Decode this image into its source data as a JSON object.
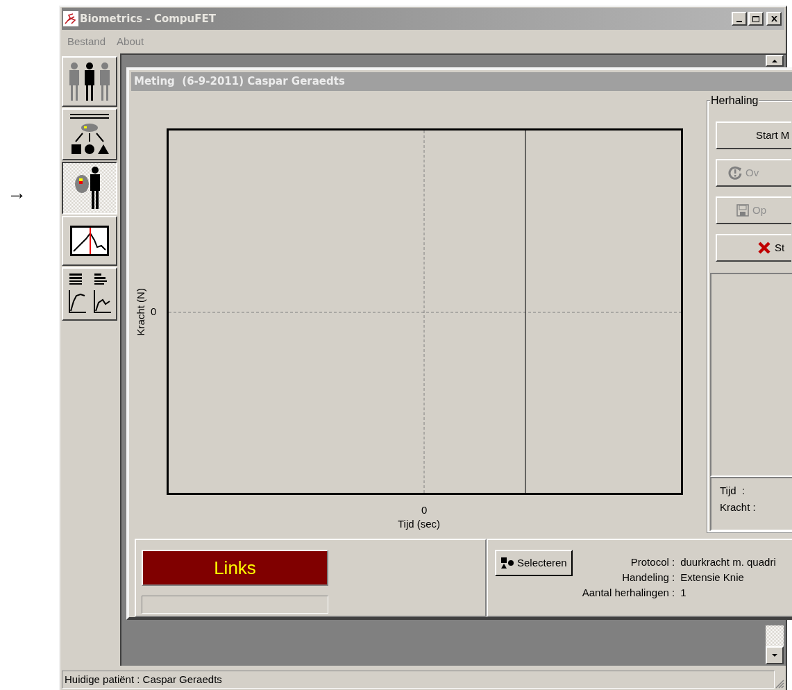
{
  "annotation": {
    "arrow": "→"
  },
  "window": {
    "title": "Biometrics - CompuFET"
  },
  "menu": [
    {
      "label": "Bestand"
    },
    {
      "label": "About"
    }
  ],
  "toolbar": [
    {
      "kind": "patients",
      "selected": false
    },
    {
      "kind": "protocols",
      "selected": false
    },
    {
      "kind": "measure",
      "selected": true
    },
    {
      "kind": "analysis",
      "selected": false
    },
    {
      "kind": "reports",
      "selected": false
    }
  ],
  "child_window": {
    "title": "Meting  (6-9-2011) Caspar Geraedts"
  },
  "plot": {
    "ylabel": "Kracht (N)",
    "ytick": "0",
    "xtick": "0",
    "xlabel": "Tijd (sec)"
  },
  "herhaling": {
    "title": "Herhaling",
    "buttons": [
      {
        "label": "Start M",
        "kind": "start",
        "disabled": false
      },
      {
        "label": "Ov",
        "kind": "retry",
        "disabled": true
      },
      {
        "label": "Op",
        "kind": "save",
        "disabled": true
      },
      {
        "label": "St",
        "kind": "stop",
        "disabled": false
      }
    ],
    "readouts": [
      {
        "label": "Tijd  :"
      },
      {
        "label": "Kracht :"
      }
    ]
  },
  "side": {
    "label": "Links",
    "level": 0
  },
  "selection": {
    "button": "Selecteren",
    "fields": [
      {
        "label": "Protocol :",
        "value": "duurkracht m. quadri"
      },
      {
        "label": "Handeling :",
        "value": "Extensie Knie"
      },
      {
        "label": "Aantal herhalingen :",
        "value": "1"
      }
    ]
  },
  "status_bar": "Huidige patiënt : Caspar Geraedts"
}
